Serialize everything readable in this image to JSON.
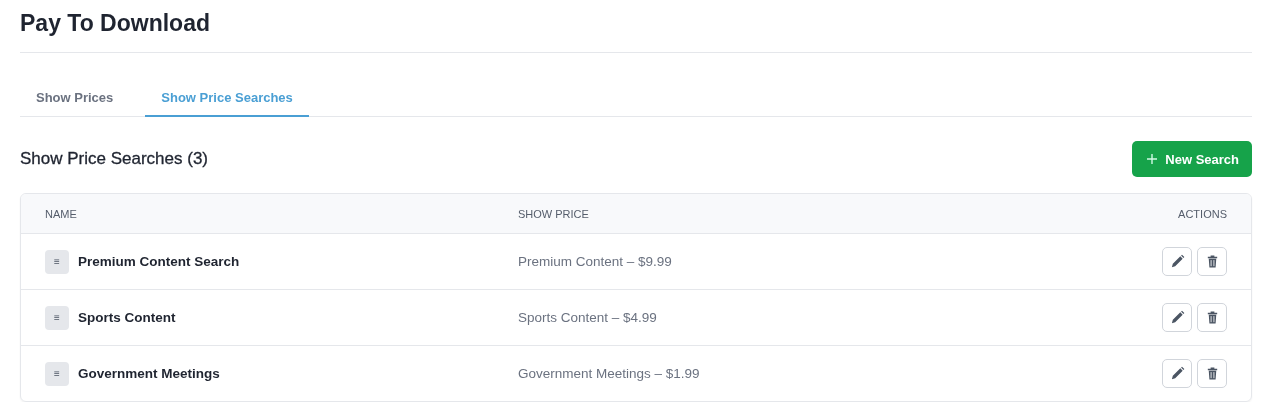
{
  "page_title": "Pay To Download",
  "tabs": [
    {
      "label": "Show Prices",
      "selected": false
    },
    {
      "label": "Show Price Searches",
      "selected": true
    }
  ],
  "section": {
    "title": "Show Price Searches (3)",
    "new_button": "New Search"
  },
  "table": {
    "columns": [
      "NAME",
      "SHOW PRICE",
      "ACTIONS"
    ],
    "rows": [
      {
        "handle": "≡",
        "name": "Premium Content Search",
        "show_price": "Premium Content – $9.99"
      },
      {
        "handle": "≡",
        "name": "Sports Content",
        "show_price": "Sports Content – $4.99"
      },
      {
        "handle": "≡",
        "name": "Government Meetings",
        "show_price": "Government Meetings – $1.99"
      }
    ]
  }
}
